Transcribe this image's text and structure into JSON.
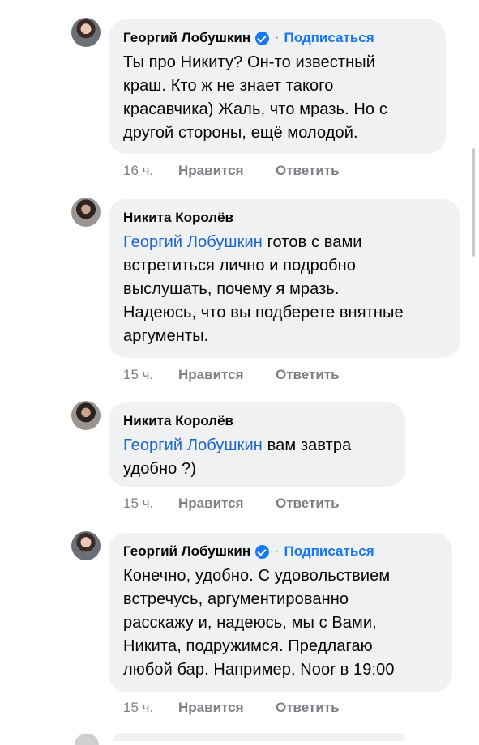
{
  "comments": [
    {
      "author": "Георгий Лобушкин",
      "verified": true,
      "follow_label": "Подписаться",
      "separator": "·",
      "mention": "",
      "lines": [
        "Ты про Никиту? Он-то известный",
        "краш. Кто ж не знает такого",
        "красавчика) Жаль, что мразь. Но с",
        "другой стороны, ещё молодой."
      ],
      "time": "16 ч.",
      "like_label": "Нравится",
      "reply_label": "Ответить"
    },
    {
      "author": "Никита Королёв",
      "verified": false,
      "mention": "Георгий Лобушкин",
      "lines": [
        " готов с вами",
        "встретиться лично и подробно",
        "выслушать, почему я мразь.",
        "Надеюсь, что вы подберете внятные",
        "аргументы."
      ],
      "time": "15 ч.",
      "like_label": "Нравится",
      "reply_label": "Ответить"
    },
    {
      "author": "Никита Королёв",
      "verified": false,
      "mention": "Георгий Лобушкин",
      "lines": [
        " вам завтра",
        "удобно ?)"
      ],
      "time": "15 ч.",
      "like_label": "Нравится",
      "reply_label": "Ответить"
    },
    {
      "author": "Георгий Лобушкин",
      "verified": true,
      "follow_label": "Подписаться",
      "separator": "·",
      "mention": "",
      "lines": [
        "Конечно, удобно. С удовольствием",
        "встречусь, аргументированно",
        "расскажу и, надеюсь, мы с Вами,",
        "Никита, подружимся. Предлагаю",
        "любой бар. Например, Noor в 19:00"
      ],
      "time": "15 ч.",
      "like_label": "Нравится",
      "reply_label": "Ответить"
    }
  ],
  "colors": {
    "link": "#1877f2",
    "mention": "#1d66c9",
    "bubble": "#eff1f3",
    "meta": "#7c7f84"
  }
}
